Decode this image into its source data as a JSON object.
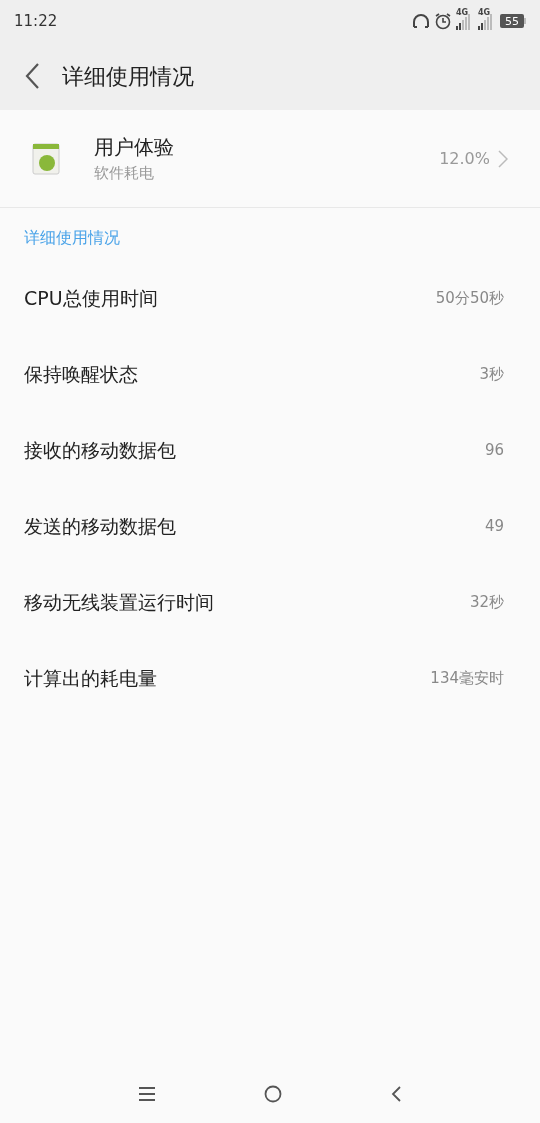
{
  "status_bar": {
    "time": "11:22",
    "network_1": "4G",
    "network_2": "4G",
    "battery": "55"
  },
  "header": {
    "title": "详细使用情况"
  },
  "app": {
    "name": "用户体验",
    "subtitle": "软件耗电",
    "percent": "12.0%"
  },
  "section": {
    "title": "详细使用情况"
  },
  "rows": [
    {
      "label": "CPU总使用时间",
      "value": "50分50秒"
    },
    {
      "label": "保持唤醒状态",
      "value": "3秒"
    },
    {
      "label": "接收的移动数据包",
      "value": "96"
    },
    {
      "label": "发送的移动数据包",
      "value": "49"
    },
    {
      "label": "移动无线装置运行时间",
      "value": "32秒"
    },
    {
      "label": "计算出的耗电量",
      "value": "134毫安时"
    }
  ]
}
